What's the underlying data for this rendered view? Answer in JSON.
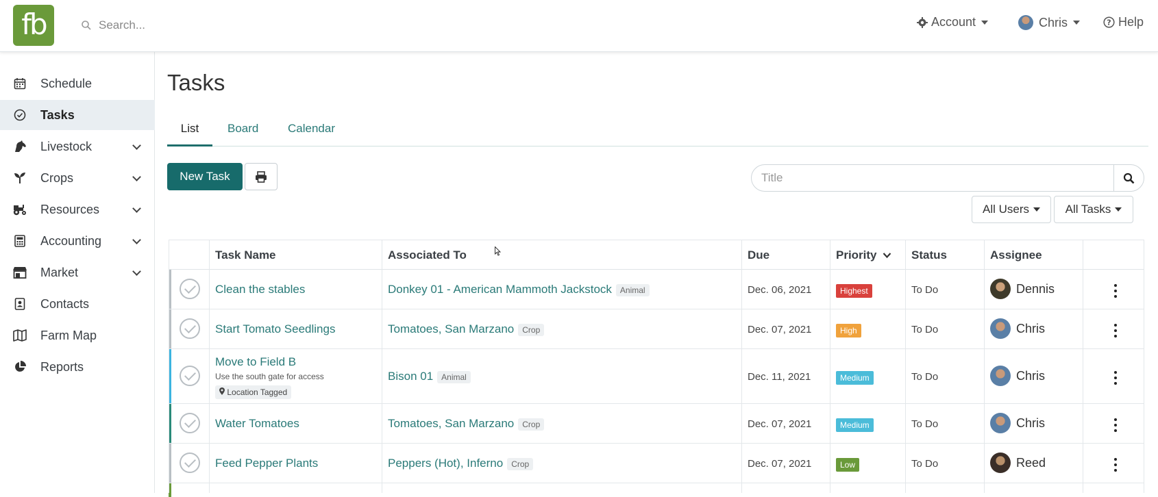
{
  "header": {
    "logo_text": "fb",
    "search_placeholder": "Search...",
    "account_label": "Account",
    "user_label": "Chris",
    "help_label": "Help"
  },
  "sidebar": {
    "items": [
      {
        "label": "Schedule",
        "icon": "calendar-icon",
        "expandable": false,
        "active": false
      },
      {
        "label": "Tasks",
        "icon": "check-circle-icon",
        "expandable": false,
        "active": true
      },
      {
        "label": "Livestock",
        "icon": "horse-icon",
        "expandable": true,
        "active": false
      },
      {
        "label": "Crops",
        "icon": "seedling-icon",
        "expandable": true,
        "active": false
      },
      {
        "label": "Resources",
        "icon": "tractor-icon",
        "expandable": true,
        "active": false
      },
      {
        "label": "Accounting",
        "icon": "calculator-icon",
        "expandable": true,
        "active": false
      },
      {
        "label": "Market",
        "icon": "store-icon",
        "expandable": true,
        "active": false
      },
      {
        "label": "Contacts",
        "icon": "address-book-icon",
        "expandable": false,
        "active": false
      },
      {
        "label": "Farm Map",
        "icon": "map-icon",
        "expandable": false,
        "active": false
      },
      {
        "label": "Reports",
        "icon": "pie-chart-icon",
        "expandable": false,
        "active": false
      }
    ]
  },
  "main": {
    "title": "Tasks",
    "tabs": [
      {
        "label": "List",
        "active": true
      },
      {
        "label": "Board",
        "active": false
      },
      {
        "label": "Calendar",
        "active": false
      }
    ],
    "new_task_label": "New Task",
    "title_search_placeholder": "Title",
    "filter_users": "All Users",
    "filter_tasks": "All Tasks"
  },
  "table": {
    "columns": [
      "Task Name",
      "Associated To",
      "Due",
      "Priority",
      "Status",
      "Assignee"
    ],
    "rows": [
      {
        "name": "Clean the stables",
        "description": "",
        "location_tag": "",
        "associated": "Donkey 01 - American Mammoth Jackstock",
        "assoc_type": "Animal",
        "due": "Dec. 06, 2021",
        "priority": "Highest",
        "priority_color": "#d9413c",
        "status": "To Do",
        "assignee": "Dennis",
        "bar_color": "#b9bfc4"
      },
      {
        "name": "Start Tomato Seedlings",
        "description": "",
        "location_tag": "",
        "associated": "Tomatoes, San Marzano",
        "assoc_type": "Crop",
        "due": "Dec. 07, 2021",
        "priority": "High",
        "priority_color": "#f0a23c",
        "status": "To Do",
        "assignee": "Chris",
        "bar_color": "#b9bfc4"
      },
      {
        "name": "Move to Field B",
        "description": "Use the south gate for access",
        "location_tag": "Location Tagged",
        "associated": "Bison 01",
        "assoc_type": "Animal",
        "due": "Dec. 11, 2021",
        "priority": "Medium",
        "priority_color": "#4bbcd9",
        "status": "To Do",
        "assignee": "Chris",
        "bar_color": "#3cb4e0"
      },
      {
        "name": "Water Tomatoes",
        "description": "",
        "location_tag": "",
        "associated": "Tomatoes, San Marzano",
        "assoc_type": "Crop",
        "due": "Dec. 07, 2021",
        "priority": "Medium",
        "priority_color": "#4bbcd9",
        "status": "To Do",
        "assignee": "Chris",
        "bar_color": "#2a8a7a"
      },
      {
        "name": "Feed Pepper Plants",
        "description": "",
        "location_tag": "",
        "associated": "Peppers (Hot), Inferno",
        "assoc_type": "Crop",
        "due": "Dec. 07, 2021",
        "priority": "Low",
        "priority_color": "#6a9a3a",
        "status": "To Do",
        "assignee": "Reed",
        "bar_color": "#b9bfc4"
      }
    ]
  }
}
